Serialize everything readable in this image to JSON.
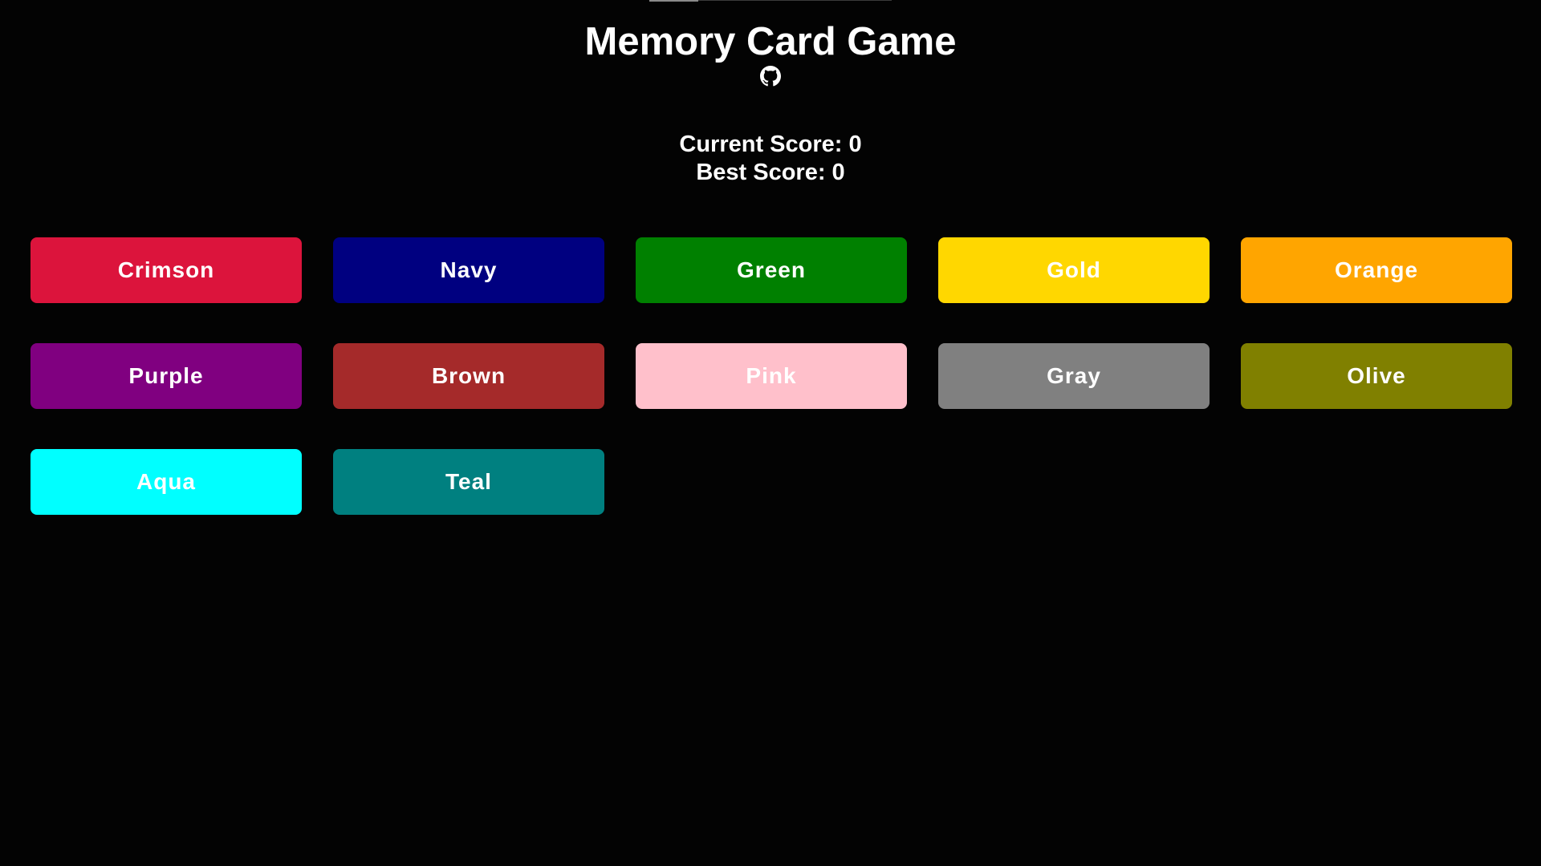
{
  "header": {
    "title": "Memory Card Game",
    "github_icon": "github-icon"
  },
  "scores": {
    "current_label": "Current Score: 0",
    "best_label": "Best Score: 0"
  },
  "cards": [
    {
      "label": "Crimson",
      "color": "#DC143C"
    },
    {
      "label": "Navy",
      "color": "#000080"
    },
    {
      "label": "Green",
      "color": "#008000"
    },
    {
      "label": "Gold",
      "color": "#FFD700"
    },
    {
      "label": "Orange",
      "color": "#FFA500"
    },
    {
      "label": "Purple",
      "color": "#800080"
    },
    {
      "label": "Brown",
      "color": "#A52A2A"
    },
    {
      "label": "Pink",
      "color": "#FFC0CB"
    },
    {
      "label": "Gray",
      "color": "#808080"
    },
    {
      "label": "Olive",
      "color": "#808000"
    },
    {
      "label": "Aqua",
      "color": "#00FFFF"
    },
    {
      "label": "Teal",
      "color": "#008080"
    }
  ],
  "colors": {
    "background": "#030303",
    "text": "#FFFFFF"
  }
}
